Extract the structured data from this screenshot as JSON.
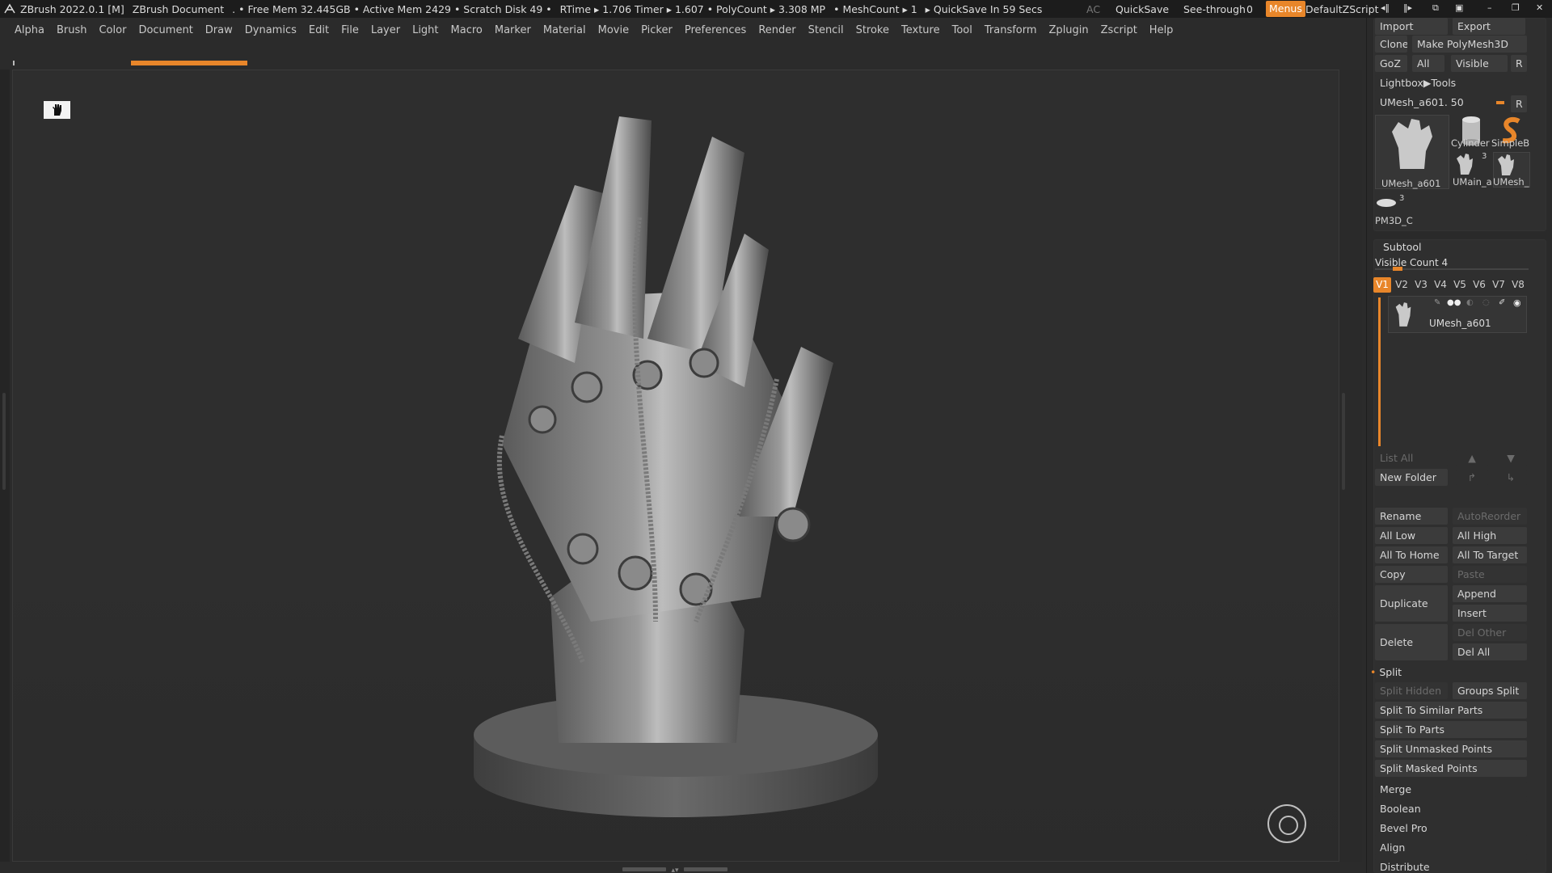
{
  "titlebar": {
    "app": "ZBrush 2022.0.1 [M]",
    "doc": "ZBrush Document",
    "stats": ". • Free Mem 32.445GB • Active Mem 2429 • Scratch Disk 49 •",
    "rtime": "RTime ▸ 1.706 Timer ▸ 1.607 • PolyCount ▸ 3.308 MP",
    "meshcount": "• MeshCount ▸ 1",
    "quicksave_timer": "▸ QuickSave In 59 Secs",
    "ac": "AC",
    "quicksave": "QuickSave",
    "seethrough_label": "See-through",
    "seethrough_value": "0",
    "seethrough_level": 0,
    "menus": "Menus",
    "defaultzscript": "DefaultZScript",
    "accent_color": "#e8862a"
  },
  "menu": [
    "Alpha",
    "Brush",
    "Color",
    "Document",
    "Draw",
    "Dynamics",
    "Edit",
    "File",
    "Layer",
    "Light",
    "Macro",
    "Marker",
    "Material",
    "Movie",
    "Picker",
    "Preferences",
    "Render",
    "Stencil",
    "Stroke",
    "Texture",
    "Tool",
    "Transform",
    "Zplugin",
    "Zscript",
    "Help"
  ],
  "progress": {
    "fill_fraction": 0.5
  },
  "icons": {
    "cursor": "hand-cursor-icon",
    "nav": "navigation-circle-icon",
    "lock": "lock-icon"
  },
  "tool": {
    "import": "Import",
    "export": "Export",
    "clone": "Clone",
    "make_polymesh": "Make PolyMesh3D",
    "goz": "GoZ",
    "all": "All",
    "visible": "Visible",
    "r": "R",
    "lightbox": "Lightbox▶Tools",
    "current_tool": "UMesh_a601.",
    "current_value": "50",
    "r2": "R",
    "thumbs": {
      "main": "UMesh_a601",
      "cylinder": "Cylinder",
      "simpleb": "SimpleB",
      "umain": "UMain_a",
      "umain_count": "3",
      "umesh": "UMesh_",
      "pm3d": "PM3D_C",
      "pm3d_count": "3"
    }
  },
  "subtool": {
    "title": "Subtool",
    "visible_count": "Visible Count 4",
    "tabs": [
      "V1",
      "V2",
      "V3",
      "V4",
      "V5",
      "V6",
      "V7",
      "V8"
    ],
    "item_name": "UMesh_a601",
    "list_all": "List All",
    "new_folder": "New Folder",
    "rename": "Rename",
    "autoreorder": "AutoReorder",
    "all_low": "All Low",
    "all_high": "All High",
    "all_to_home": "All To Home",
    "all_to_target": "All To Target",
    "copy": "Copy",
    "paste": "Paste",
    "duplicate": "Duplicate",
    "append": "Append",
    "insert": "Insert",
    "delete": "Delete",
    "del_other": "Del Other",
    "del_all": "Del All",
    "split": "Split",
    "split_hidden": "Split Hidden",
    "groups_split": "Groups Split",
    "split_similar": "Split To Similar Parts",
    "split_parts": "Split To Parts",
    "split_unmasked": "Split Unmasked Points",
    "split_masked": "Split Masked Points",
    "merge": "Merge",
    "boolean": "Boolean",
    "bevel_pro": "Bevel Pro",
    "align": "Align",
    "distribute": "Distribute"
  }
}
